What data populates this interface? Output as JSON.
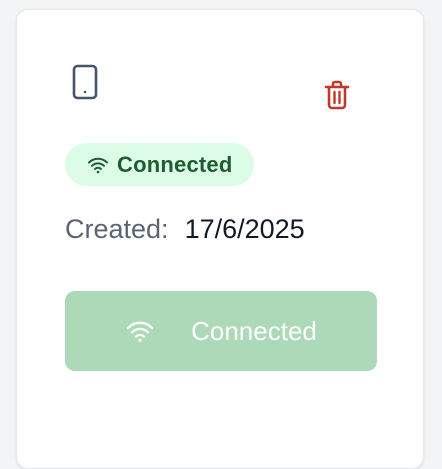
{
  "card": {
    "device_icon": "smartphone-icon",
    "delete_icon": "trash-icon",
    "status": {
      "icon": "wifi-icon",
      "label": "Connected",
      "background_color": "#dcfce7",
      "text_color": "#1f5c33"
    },
    "created": {
      "label": "Created:",
      "value": "17/6/2025"
    },
    "action_button": {
      "icon": "wifi-icon",
      "label": "Connected",
      "background_color": "#acd9b7",
      "text_color": "#ffffff"
    },
    "colors": {
      "delete": "#c0392b",
      "device_icon": "#475569"
    }
  }
}
